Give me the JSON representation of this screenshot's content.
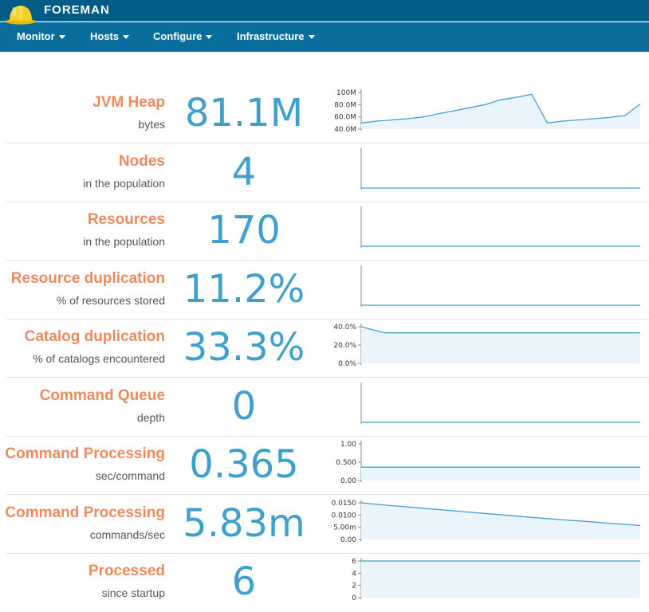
{
  "header": {
    "brand": "FOREMAN",
    "nav": [
      {
        "label": "Monitor"
      },
      {
        "label": "Hosts"
      },
      {
        "label": "Configure"
      },
      {
        "label": "Infrastructure"
      }
    ]
  },
  "colors": {
    "topbar": "#005b86",
    "navbar": "#0a6e9c",
    "metric_title": "#ee8a5e",
    "metric_value": "#3f9fcf",
    "sparkline": "#3f9fcf",
    "sparkline_fill": "#e9f4fb"
  },
  "metrics": [
    {
      "name": "JVM Heap",
      "desc": "bytes",
      "value": "81.1M",
      "ticks": [
        "100M",
        "80.0M",
        "60.0M",
        "40.0M"
      ],
      "ymin": 40,
      "ymax": 100,
      "series": [
        50,
        53,
        55,
        57,
        60,
        65,
        70,
        75,
        80,
        88,
        92,
        97,
        50,
        53,
        55,
        57,
        59,
        62,
        81
      ]
    },
    {
      "name": "Nodes",
      "desc": "in the population",
      "value": "4",
      "ticks": [],
      "series": []
    },
    {
      "name": "Resources",
      "desc": "in the population",
      "value": "170",
      "ticks": [],
      "series": []
    },
    {
      "name": "Resource duplication",
      "desc": "% of resources stored",
      "value": "11.2%",
      "ticks": [],
      "series": []
    },
    {
      "name": "Catalog duplication",
      "desc": "% of catalogs encountered",
      "value": "33.3%",
      "ticks": [
        "40.0%",
        "20.0%",
        "0.0%"
      ],
      "ymin": 0,
      "ymax": 40,
      "series": [
        40,
        33.3,
        33.3,
        33.3,
        33.3,
        33.3,
        33.3,
        33.3,
        33.3,
        33.3,
        33.3,
        33.3,
        33.3
      ]
    },
    {
      "name": "Command Queue",
      "desc": "depth",
      "value": "0",
      "ticks": [],
      "series": []
    },
    {
      "name": "Command Processing",
      "desc": "sec/command",
      "value": "0.365",
      "ticks": [
        "1.00",
        "0.500",
        "0.00"
      ],
      "ymin": 0,
      "ymax": 1,
      "series": [
        0.365,
        0.365,
        0.365,
        0.365,
        0.365,
        0.365,
        0.365,
        0.365,
        0.365,
        0.365
      ]
    },
    {
      "name": "Command Processing",
      "desc": "commands/sec",
      "value": "5.83m",
      "ticks": [
        "0.0150",
        "0.0100",
        "5.00m",
        "0.00"
      ],
      "ymin": 0,
      "ymax": 0.0155,
      "series": [
        0.0155,
        0.0145,
        0.0136,
        0.0127,
        0.0118,
        0.0109,
        0.01,
        0.0091,
        0.0083,
        0.0075,
        0.0067,
        0.0059
      ]
    },
    {
      "name": "Processed",
      "desc": "since startup",
      "value": "6",
      "ticks": [
        "6",
        "4",
        "2",
        "0"
      ],
      "ymin": 0,
      "ymax": 6,
      "series": [
        6,
        6,
        6,
        6,
        6,
        6,
        6,
        6,
        6,
        6
      ]
    }
  ]
}
